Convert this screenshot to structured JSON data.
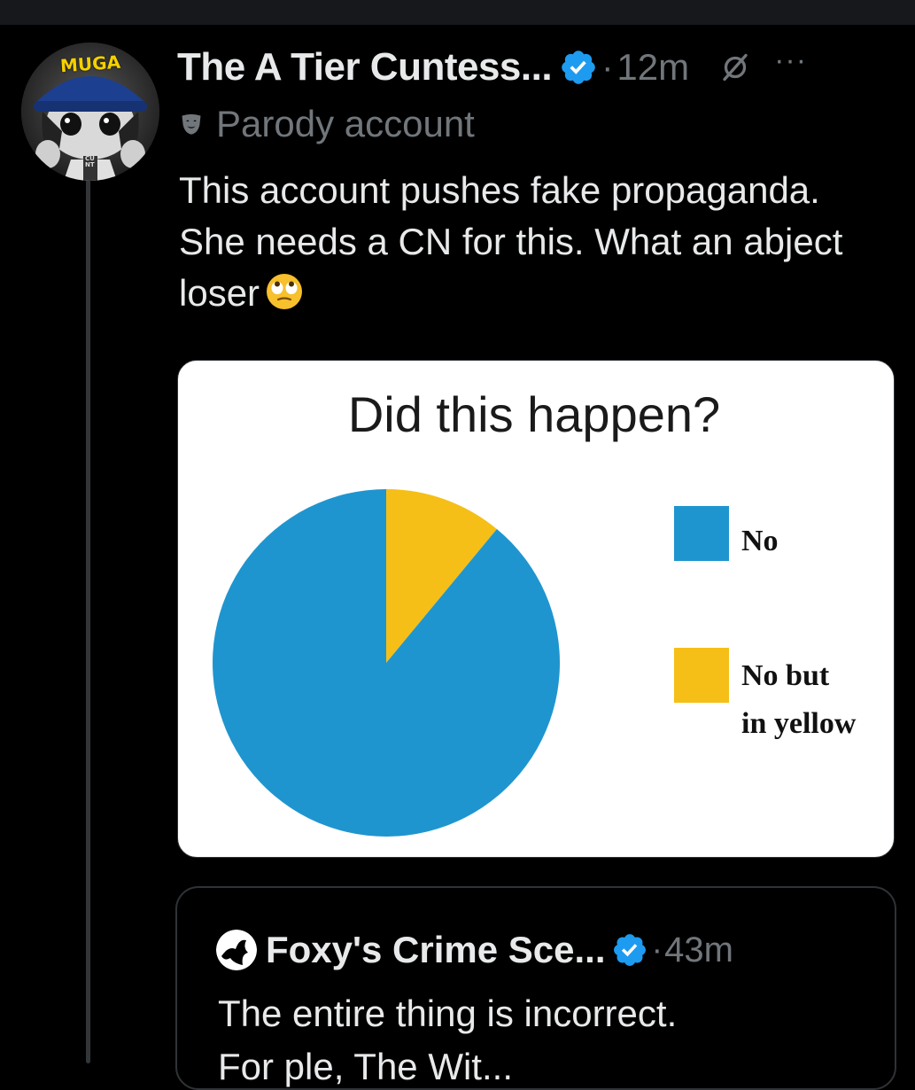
{
  "tweet": {
    "display_name": "The A Tier Cuntess...",
    "timestamp": "12m",
    "dot": "·",
    "more": "···",
    "parody_label": "Parody account",
    "text": "This account pushes fake propaganda. She needs a CN for this. What an abject loser",
    "avatar_cap_text": "MUGA",
    "avatar_shirt_text": "CUNT",
    "colors": {
      "verified": "#1d9bf0",
      "muted": "#71767b",
      "text": "#e7e9ea",
      "background": "#000000"
    }
  },
  "media": {
    "title": "Did this happen?",
    "legend": [
      {
        "label_line1": "No",
        "label_line2": "",
        "color": "#1f95cf"
      },
      {
        "label_line1": "No but",
        "label_line2": "in yellow",
        "color": "#f5bf17"
      }
    ]
  },
  "chart_data": {
    "type": "pie",
    "title": "Did this happen?",
    "categories": [
      "No",
      "No but in yellow"
    ],
    "values": [
      89,
      11
    ],
    "colors": [
      "#1f95cf",
      "#f5bf17"
    ],
    "legend_position": "right"
  },
  "quote": {
    "display_name": "Foxy's Crime Sce...",
    "timestamp": "43m",
    "dot": "·",
    "text": "The entire thing is incorrect.",
    "text_partial": "For ple, The Wit..."
  }
}
